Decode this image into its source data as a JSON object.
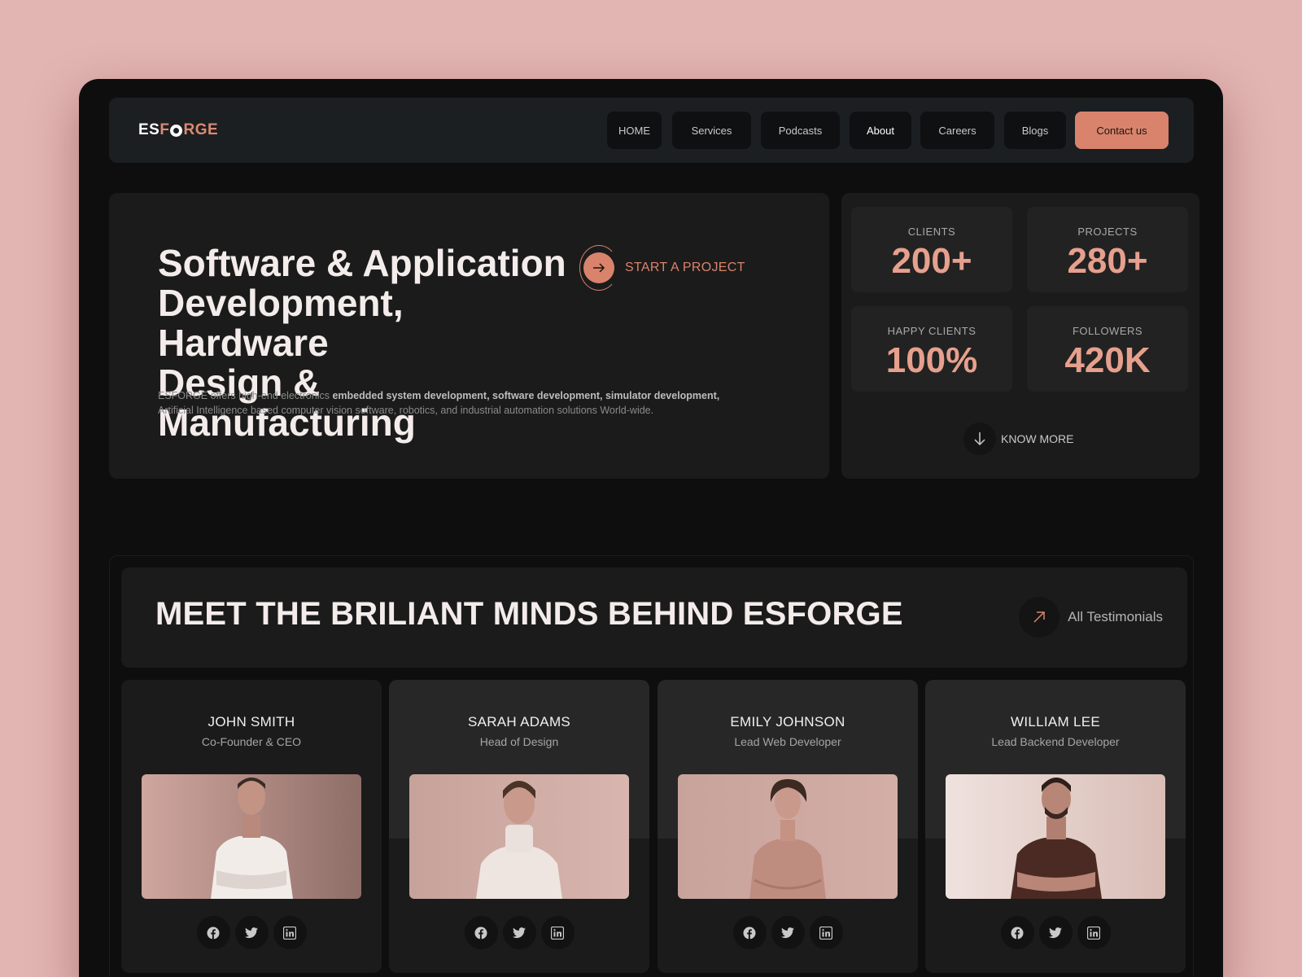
{
  "brand": {
    "logo_left": "ES",
    "logo_right": "RGE"
  },
  "nav": {
    "items": [
      {
        "label": "HOME"
      },
      {
        "label": "Services"
      },
      {
        "label": "Podcasts"
      },
      {
        "label": "About"
      },
      {
        "label": "Careers"
      },
      {
        "label": "Blogs"
      }
    ],
    "contact_label": "Contact us"
  },
  "hero": {
    "title_line1": "Software & Application",
    "title_line2": "Development, Hardware",
    "title_line3": "Design & Manufacturing",
    "desc_prefix": "ESFORGE offers high-end electronics ",
    "desc_bold": "embedded system development, software development, simulator development,",
    "desc_suffix": "Artificial Intelligence based computer vision software, robotics, and industrial automation solutions World-wide.",
    "cta_label": "START A PROJECT"
  },
  "stats": {
    "items": [
      {
        "label": "CLIENTS",
        "value": "200+"
      },
      {
        "label": "PROJECTS",
        "value": "280+"
      },
      {
        "label": "HAPPY CLIENTS",
        "value": "100%"
      },
      {
        "label": "FOLLOWERS",
        "value": "420K"
      }
    ],
    "know_more": "KNOW MORE"
  },
  "team": {
    "heading": "MEET THE BRILIANT MINDS BEHIND ESFORGE",
    "all_label": "All  Testimonials",
    "members": [
      {
        "name": "JOHN SMITH",
        "role": "Co-Founder & CEO"
      },
      {
        "name": "SARAH ADAMS",
        "role": "Head of Design"
      },
      {
        "name": "EMILY JOHNSON",
        "role": "Lead  Web Developer"
      },
      {
        "name": "WILLIAM LEE",
        "role": "Lead  Backend Developer"
      }
    ]
  },
  "colors": {
    "accent": "#d9836c",
    "stat_value": "#e6a08d",
    "background": "#0e0e0e",
    "page_bg": "#e2b4b2"
  }
}
